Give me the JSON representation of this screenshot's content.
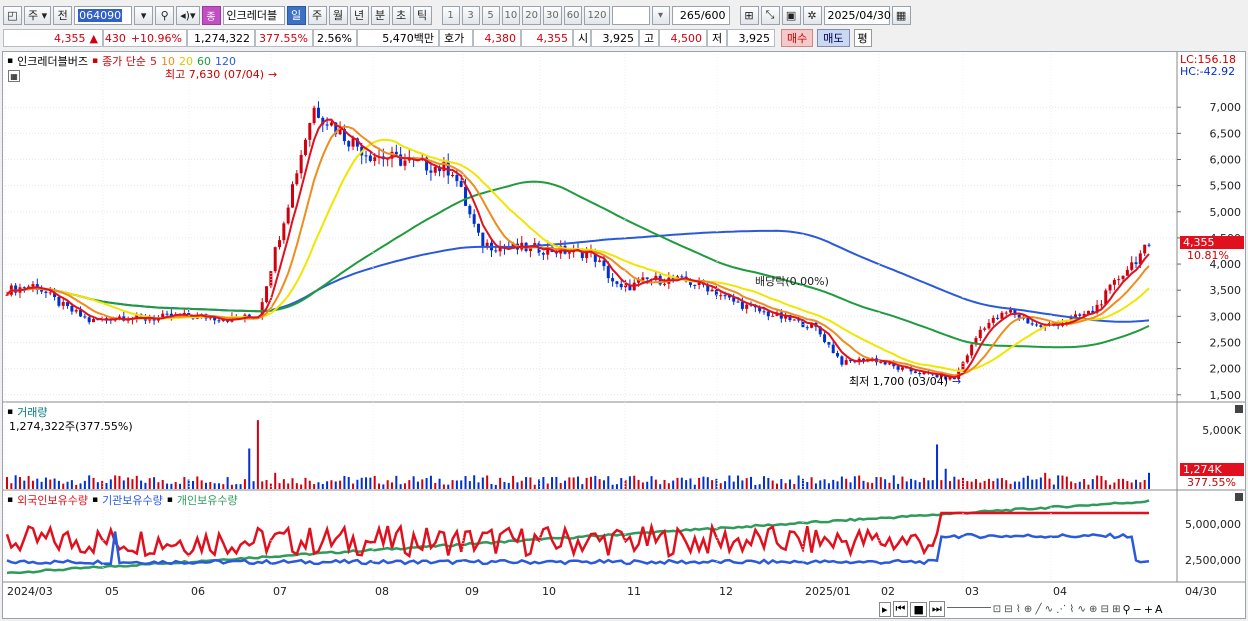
{
  "toolbar": {
    "period_type": "주",
    "prev_label": "전",
    "stock_code": "064090",
    "stock_badge": "종",
    "stock_name": "인크레더블",
    "intervals": [
      "일",
      "주",
      "월",
      "년",
      "분",
      "초",
      "틱"
    ],
    "selected_interval": "일",
    "tick_counts": [
      "1",
      "3",
      "5",
      "10",
      "20",
      "30",
      "60",
      "120"
    ],
    "bar_count": "265",
    "bar_total": "/600",
    "date": "2025/04/30"
  },
  "quote": {
    "price": "4,355",
    "change_arrow": "▲",
    "change": "430",
    "change_pct": "+10.96%",
    "volume": "1,274,322",
    "volume_ratio": "377.55%",
    "turnover_pct": "2.56%",
    "trade_value": "5,470백만",
    "ask_label": "호가",
    "ask": "4,380",
    "bid": "4,355",
    "open_label": "시",
    "open": "3,925",
    "high_label": "고",
    "high": "4,500",
    "low_label": "저",
    "low": "3,925",
    "buy_label": "매수",
    "sell_label": "매도",
    "avg_label": "평"
  },
  "price_legend": {
    "name": "인크레더블버즈",
    "ma_label": "종가 단순",
    "ma_periods": [
      "5",
      "10",
      "20",
      "60",
      "120"
    ],
    "high_annot": "최고 7,630 (07/04)",
    "low_annot": "최저 1,700 (03/04)",
    "dividend_annot": "배당락(0.00%)",
    "lc": "LC:156.18",
    "hc": "HC:-42.92",
    "current_price": "4,355",
    "current_pct": "10.81%"
  },
  "volume_legend": {
    "title": "거래량",
    "value": "1,274,322주(377.55%)",
    "current": "1,274K",
    "current_pct": "377.55%"
  },
  "holding_legend": {
    "series": [
      "외국인보유수량",
      "기관보유수량",
      "개인보유수량"
    ]
  },
  "colors": {
    "ma5": "#e0101e",
    "ma10": "#f08c1e",
    "ma20": "#f0e600",
    "ma60": "#1e9b3c",
    "ma120": "#2a5adc",
    "up": "#d2000f",
    "down": "#0030d0",
    "foreign": "#e0101e",
    "institution": "#2a5adc",
    "individual": "#2e9b5a"
  },
  "chart_data": {
    "type": "line",
    "price_axis": {
      "ticks": [
        "7,000",
        "6,500",
        "6,000",
        "5,500",
        "5,000",
        "4,500",
        "4,000",
        "3,500",
        "3,000",
        "2,500",
        "2,000",
        "1,500"
      ],
      "range": [
        1400,
        7750
      ]
    },
    "volume_axis": {
      "ticks": [
        "5,000K"
      ]
    },
    "holding_axis": {
      "ticks": [
        "5,000,000",
        "2,500,000"
      ]
    },
    "x_labels": [
      "2024/03",
      "05",
      "06",
      "07",
      "08",
      "09",
      "10",
      "11",
      "12",
      "2025/01",
      "02",
      "03",
      "04",
      "04/30"
    ],
    "approx_closes": [
      3500,
      3600,
      3200,
      2900,
      3000,
      2950,
      3000,
      3000,
      2950,
      3000,
      5000,
      7000,
      6500,
      6100,
      6000,
      5900,
      5800,
      4400,
      4300,
      4300,
      4250,
      4200,
      3500,
      3700,
      3700,
      3600,
      3300,
      3100,
      2950,
      2800,
      2100,
      2200,
      2000,
      1900,
      1800,
      2800,
      3100,
      2800,
      2900,
      3100,
      3800,
      4355
    ]
  }
}
